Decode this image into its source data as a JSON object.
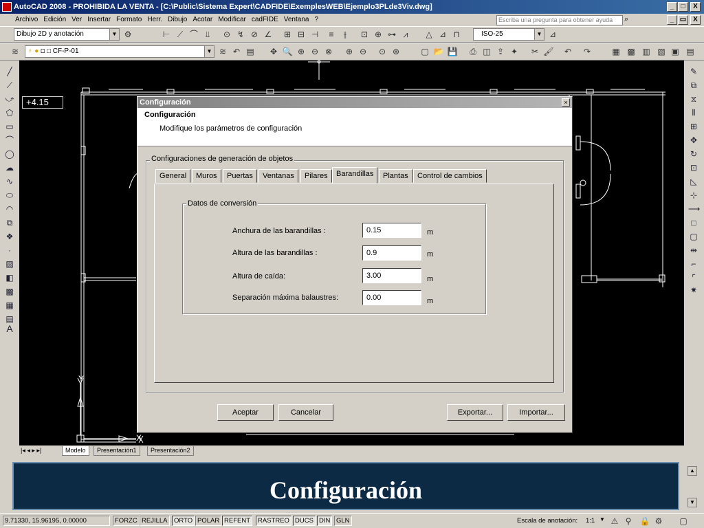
{
  "window": {
    "title": "AutoCAD 2008 - PROHIBIDA LA VENTA - [C:\\Public\\Sistema Expert\\CADFIDE\\ExemplesWEB\\Ejemplo3PLde3Viv.dwg]",
    "min": "_",
    "max": "□",
    "close": "X"
  },
  "menu": {
    "items": [
      "Archivo",
      "Edición",
      "Ver",
      "Insertar",
      "Formato",
      "Herr.",
      "Dibujo",
      "Acotar",
      "Modificar",
      "cadFIDE",
      "Ventana",
      "?"
    ],
    "help_placeholder": "Escriba una pregunta para obtener ayuda"
  },
  "toolbar": {
    "workspace": "Dibujo 2D y anotación",
    "dimstyle": "ISO-25",
    "layer": "CF-P-01"
  },
  "drawing": {
    "elevation_label": "+4.15",
    "axis_y": "Y",
    "axis_x": "X"
  },
  "layout_tabs": [
    "Modelo",
    "Presentación1",
    "Presentación2"
  ],
  "banner": {
    "text": "Configuración"
  },
  "status": {
    "coords": "9.71330, 15.96195, 0.00000",
    "toggles": [
      "FORZC",
      "REJILLA",
      "ORTO",
      "POLAR",
      "REFENT",
      "RASTREO",
      "DUCS",
      "DIN",
      "GLN"
    ],
    "annotation_scale": "Escala de anotación:",
    "scale_value": "1:1"
  },
  "dialog": {
    "title": "Configuración",
    "header_title": "Configuración",
    "header_subtitle": "Modifique los parámetros de configuración",
    "group_label": "Configuraciones de generación de objetos",
    "tabs": [
      "General",
      "Muros",
      "Puertas",
      "Ventanas",
      "Pilares",
      "Barandillas",
      "Plantas",
      "Control de cambios"
    ],
    "active_tab": "Barandillas",
    "conversion_group": "Datos de conversión",
    "fields": [
      {
        "label": "Anchura de las barandillas :",
        "value": "0.15",
        "unit": "m"
      },
      {
        "label": "Altura de las barandillas :",
        "value": "0.9",
        "unit": "m"
      },
      {
        "label": "Altura de caída:",
        "value": "3.00",
        "unit": "m"
      },
      {
        "label": "Separación máxima balaustres:",
        "value": "0.00",
        "unit": "m"
      }
    ],
    "buttons": {
      "accept": "Aceptar",
      "cancel": "Cancelar",
      "export": "Exportar...",
      "import": "Importar..."
    }
  }
}
